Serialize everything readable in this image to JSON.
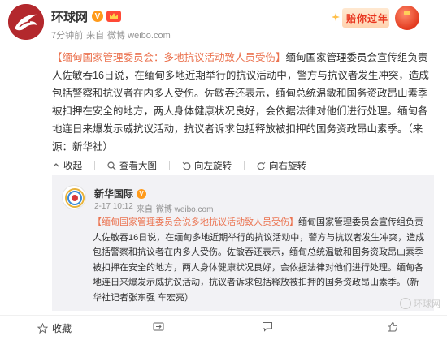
{
  "header": {
    "username": "环球网",
    "verified_symbol": "V",
    "meta": {
      "time": "7分钟前",
      "source_prefix": "来自",
      "source": "微博 weibo.com"
    },
    "promo_text": "赔你过年"
  },
  "post": {
    "tag": "【缅甸国家管理委员会：多地抗议活动致人员受伤】",
    "body": "缅甸国家管理委员会宣传组负责人佐敏吞16日说，在缅甸多地近期举行的抗议活动中，警方与抗议者发生冲突，造成包括警察和抗议者在内多人受伤。佐敏吞还表示，缅甸总统温敏和国务资政昂山素季被扣押在安全的地方，两人身体健康状况良好，会依据法律对他们进行处理。缅甸各地连日来爆发示威抗议活动，抗议者诉求包括释放被扣押的国务资政昂山素季。（来源：新华社）"
  },
  "repost_links": {
    "collapse": "收起",
    "view_large": "查看大图",
    "rotate_left": "向左旋转",
    "rotate_right": "向右旋转"
  },
  "quoted": {
    "username": "新华国际",
    "avatar_text": "新华\n国际",
    "verified_symbol": "V",
    "meta": {
      "time": "2-17 10:12",
      "source_prefix": "来自",
      "source": "微博 weibo.com"
    },
    "tag": "【缅甸国家管理委员会说多地抗议活动致人员受伤】",
    "body": "缅甸国家管理委员会宣传组负责人佐敏吞16日说，在缅甸多地近期举行的抗议活动中，警方与抗议者发生冲突，造成包括警察和抗议者在内多人受伤。佐敏吞还表示，缅甸总统温敏和国务资政昂山素季被扣押在安全的地方，两人身体健康状况良好，会依据法律对他们进行处理。缅甸各地连日来爆发示威抗议活动，抗议者诉求包括释放被扣押的国务资政昂山素季。（新华社记者张东强 车宏亮）"
  },
  "actions": {
    "favorite": "收藏",
    "repost": "",
    "comment": "",
    "like": ""
  },
  "watermark": "环球网"
}
